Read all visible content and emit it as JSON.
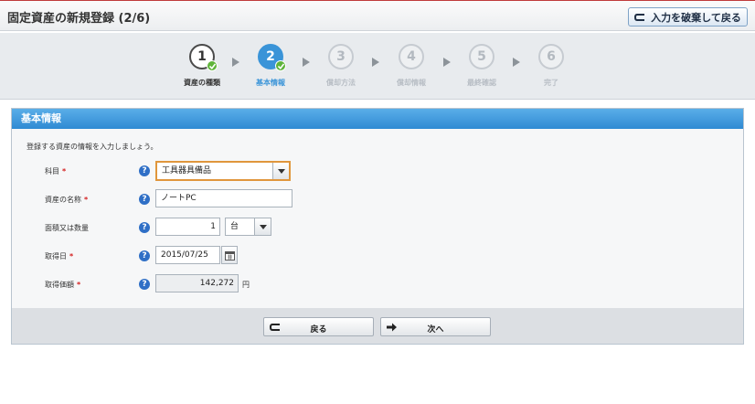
{
  "header": {
    "title": "固定資産の新規登録 (2/6)",
    "discard_label": "入力を破棄して戻る"
  },
  "steps": [
    {
      "num": "1",
      "label": "資産の種類",
      "state": "done"
    },
    {
      "num": "2",
      "label": "基本情報",
      "state": "active"
    },
    {
      "num": "3",
      "label": "償却方法",
      "state": "todo"
    },
    {
      "num": "4",
      "label": "償却情報",
      "state": "todo"
    },
    {
      "num": "5",
      "label": "最終確認",
      "state": "todo"
    },
    {
      "num": "6",
      "label": "完了",
      "state": "todo"
    }
  ],
  "panel": {
    "title": "基本情報",
    "intro": "登録する資産の情報を入力しましょう。",
    "required_mark": "*",
    "help_glyph": "?",
    "fields": {
      "account": {
        "label": "科目",
        "value": "工具器具備品"
      },
      "name": {
        "label": "資産の名称",
        "value": "ノートPC"
      },
      "quantity": {
        "label": "面積又は数量",
        "value": "1",
        "unit": "台"
      },
      "acquired_date": {
        "label": "取得日",
        "value": "2015/07/25"
      },
      "price": {
        "label": "取得価額",
        "value": "142,272",
        "unit": "円"
      }
    }
  },
  "footer": {
    "back_label": "戻る",
    "next_label": "次へ"
  },
  "colors": {
    "accent": "#3a94d8",
    "header_gradient": "#2f8ad3",
    "required": "#d42020",
    "check": "#5fb43a",
    "focus_border": "#e0963c"
  }
}
